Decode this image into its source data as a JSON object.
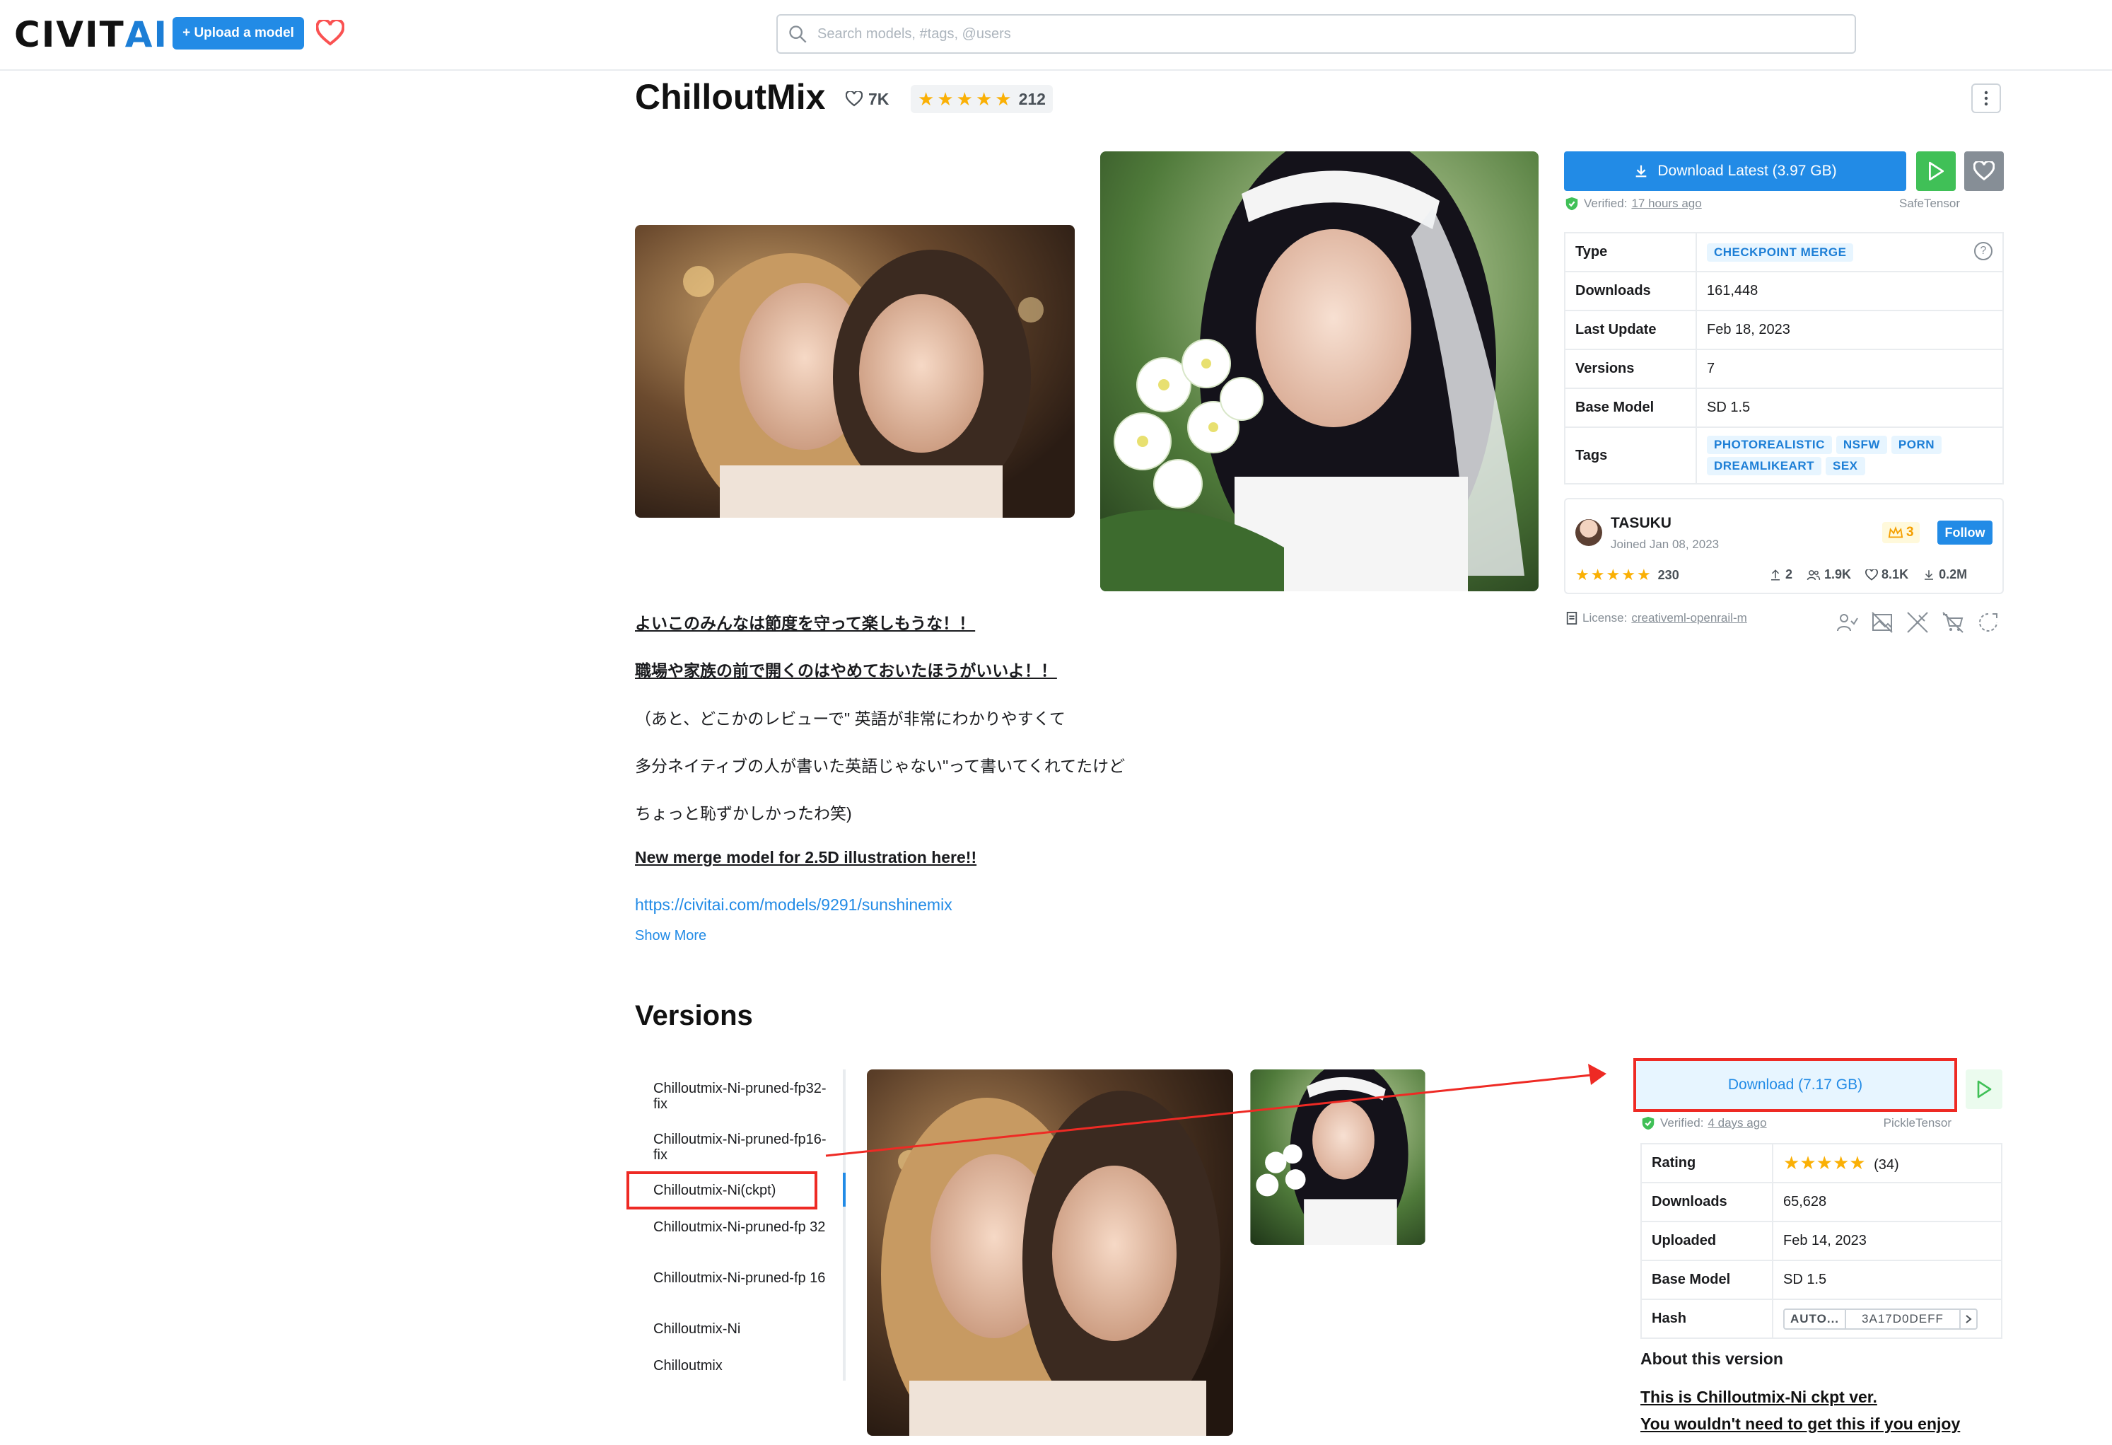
{
  "header": {
    "logo_main": "CIVIT",
    "logo_ai": "AI",
    "upload_label": "+ Upload a model",
    "search_placeholder": "Search models, #tags, @users"
  },
  "model": {
    "title": "ChilloutMix",
    "likes": "7K",
    "rating_count": "212",
    "stars": 5
  },
  "download": {
    "latest_label": "Download Latest (3.97 GB)",
    "verified_prefix": "Verified:",
    "verified_time": "17 hours ago",
    "format": "SafeTensor"
  },
  "details": {
    "type_label": "Type",
    "type_value": "CHECKPOINT MERGE",
    "downloads_label": "Downloads",
    "downloads_value": "161,448",
    "last_update_label": "Last Update",
    "last_update_value": "Feb 18, 2023",
    "versions_label": "Versions",
    "versions_value": "7",
    "base_model_label": "Base Model",
    "base_model_value": "SD 1.5",
    "tags_label": "Tags",
    "tags": [
      "PHOTOREALISTIC",
      "NSFW",
      "PORN",
      "DREAMLIKEART",
      "SEX"
    ]
  },
  "creator": {
    "name": "TASUKU",
    "joined": "Joined Jan 08, 2023",
    "crown_count": "3",
    "follow_label": "Follow",
    "rating_count": "230",
    "uploads": "2",
    "followers": "1.9K",
    "likes": "8.1K",
    "downloads": "0.2M"
  },
  "license": {
    "prefix": "License:",
    "name": "creativeml-openrail-m"
  },
  "description": {
    "line1": "よいこのみんなは節度を守って楽しもうな！！",
    "line2": "職場や家族の前で開くのはやめておいたほうがいいよ！！",
    "line3": "（あと、どこかのレビューで\" 英語が非常にわかりやすくて",
    "line4": "多分ネイティブの人が書いた英語じゃない\"って書いてくれてたけど",
    "line5": "ちょっと恥ずかしかったわ笑)",
    "line6": "New merge model for 2.5D illustration here!!",
    "link": "https://civitai.com/models/9291/sunshinemix",
    "show_more": "Show More"
  },
  "versions": {
    "title": "Versions",
    "items": [
      "Chilloutmix-Ni-pruned-fp32-fix",
      "Chilloutmix-Ni-pruned-fp16-fix",
      "Chilloutmix-Ni(ckpt)",
      "Chilloutmix-Ni-pruned-fp 32",
      "Chilloutmix-Ni-pruned-fp 16",
      "Chilloutmix-Ni",
      "Chilloutmix"
    ],
    "active_index": 2,
    "download_label": "Download (7.17 GB)",
    "verified_prefix": "Verified:",
    "verified_time": "4 days ago",
    "format": "PickleTensor",
    "rating_label": "Rating",
    "rating_count": "(34)",
    "downloads_label": "Downloads",
    "downloads_value": "65,628",
    "uploaded_label": "Uploaded",
    "uploaded_value": "Feb 14, 2023",
    "base_model_label": "Base Model",
    "base_model_value": "SD 1.5",
    "hash_label": "Hash",
    "hash_algo": "AUTO...",
    "hash_value": "3A17D0DEFF",
    "about_title": "About this version",
    "about_line1": "This is Chilloutmix-Ni ckpt ver.",
    "about_line2": "You wouldn't need to get this if you enjoy"
  },
  "colors": {
    "accent": "#228be6",
    "annotation_red": "#ee2a24",
    "star": "#fab005",
    "green": "#40c057"
  }
}
